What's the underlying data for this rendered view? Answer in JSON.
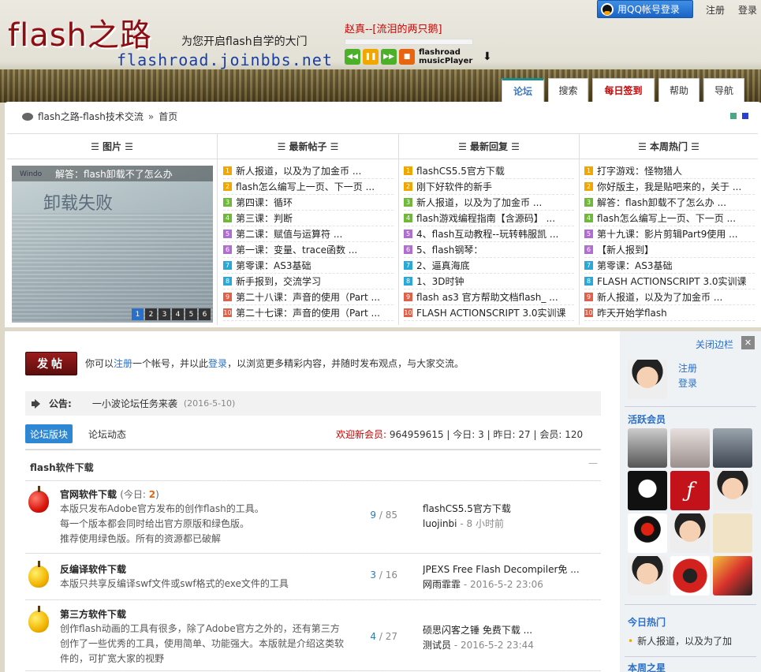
{
  "header": {
    "logo_title": "flash之路",
    "slogan": "为您开启flash自学的大门",
    "url": "flashroad.joinbbs.net",
    "player": {
      "song": "赵真--[流泪的两只鹅]",
      "name_line1": "flashroad",
      "name_line2": "musicPlayer",
      "buttons": [
        "prev-icon",
        "pause-icon",
        "next-icon",
        "stop-icon"
      ]
    },
    "qq_login": "用QQ帐号登录",
    "register": "注册",
    "login": "登录"
  },
  "nav": {
    "tabs": [
      {
        "label": "论坛",
        "state": "active"
      },
      {
        "label": "搜索",
        "state": "normal"
      },
      {
        "label": "每日签到",
        "state": "hot"
      },
      {
        "label": "帮助",
        "state": "normal"
      },
      {
        "label": "导航",
        "state": "normal"
      }
    ]
  },
  "breadcrumb": {
    "site": "flash之路-flash技术交流",
    "sep": "»",
    "current": "首页"
  },
  "columns": {
    "pictures": {
      "title": "☰ 图片 ☰",
      "caption": "解答：flash卸载不了怎么办",
      "big_text": "卸载失败",
      "small_text": "Windo",
      "pages": [
        "1",
        "2",
        "3",
        "4",
        "5",
        "6"
      ],
      "active_page": "1"
    },
    "new_threads": {
      "title": "☰ 最新帖子 ☰",
      "items": [
        "新人报道，以及为了加金币 ...",
        "flash怎么编写上一页、下一页 ...",
        "第四课：循环",
        "第三课：判断",
        "第二课：赋值与运算符 ...",
        "第一课：变量、trace函数 ...",
        "第零课：AS3基础",
        "新手报到，交流学习",
        "第二十八课：声音的使用（Part ...",
        "第二十七课：声音的使用（Part ..."
      ]
    },
    "new_replies": {
      "title": "☰ 最新回复 ☰",
      "items": [
        "flashCS5.5官方下载",
        "刚下好软件的新手",
        "新人报道，以及为了加金币 ...",
        "flash游戏编程指南【含源码】 ...",
        "4、flash互动教程--玩转韩服凯 ...",
        "5、flash钢琴：",
        "2、逼真海底",
        "1、3D时钟",
        "flash as3 官方帮助文档flash_ ...",
        "FLASH ACTIONSCRIPT 3.0实训课"
      ]
    },
    "weekly_hot": {
      "title": "☰ 本周热门 ☰",
      "items": [
        "打字游戏：怪物猎人",
        "你好版主，我是贴吧来的，关于 ...",
        "解答：flash卸载不了怎么办 ...",
        "flash怎么编写上一页、下一页 ...",
        "第十九课：影片剪辑Part9使用 ...",
        "【新人报到】",
        "第零课：AS3基础",
        "FLASH ACTIONSCRIPT 3.0实训课",
        "新人报道，以及为了加金币 ...",
        "昨天开始学flash"
      ]
    },
    "number_labels": [
      "1",
      "2",
      "3",
      "4",
      "5",
      "6",
      "7",
      "8",
      "9",
      "10"
    ],
    "number_colors": [
      "#f2a700",
      "#f2a700",
      "#6fb83a",
      "#6fb83a",
      "#b06fd0",
      "#b06fd0",
      "#2aa8d8",
      "#2aa8d8",
      "#e0604a",
      "#e0604a"
    ]
  },
  "post": {
    "button": "发帖",
    "text_prefix": "你可以",
    "register_link": "注册",
    "text_mid": "一个帐号，并以此",
    "login_link": "登录",
    "text_suffix": "，以浏览更多精彩内容，并随时发布观点，与大家交流。"
  },
  "notice": {
    "label": "公告:",
    "text": "一小波论坛任务来袭",
    "date": "(2016-5-10)"
  },
  "tabs2": {
    "board": "论坛版块",
    "activity": "论坛动态"
  },
  "stats": {
    "welcome_label": "欢迎新会员:",
    "welcome_value": "964959615",
    "today": "今日: 3",
    "yesterday": "昨日: 27",
    "members": "会员: 120",
    "sep": "|"
  },
  "section": {
    "title": "flash软件下载",
    "collapse": "—",
    "forums": [
      {
        "name": "官网软件下载",
        "today_label": "(今日:",
        "today_value": "2",
        "today_close": ")",
        "desc": [
          "本版只发布Adobe官方发布的创作flash的工具。",
          "每一个版本都会同时给出官方原版和绿色版。",
          "推荐使用绿色版。所有的资源都已破解"
        ],
        "threads": "9",
        "posts": "85",
        "last_title": "flashCS5.5官方下载",
        "last_user": "luojinbi",
        "last_time": "8 小时前",
        "icon": "red-apple-icon"
      },
      {
        "name": "反编译软件下载",
        "desc": [
          "本版只共享反编译swf文件或swf格式的exe文件的工具"
        ],
        "threads": "3",
        "posts": "16",
        "last_title": "JPEXS Free Flash Decompiler免 ...",
        "last_user": "网雨霏霏",
        "last_time": "2016-5-2 23:06",
        "icon": "yellow-apple-icon"
      },
      {
        "name": "第三方软件下载",
        "desc": [
          "创作flash动画的工具有很多，除了Adobe官方之外的，还有第三方",
          "创作了一些优秀的工具，使用简单、功能强大。本版就是介绍这类软",
          "件的，可扩宽大家的视野"
        ],
        "threads": "4",
        "posts": "27",
        "last_title": "硕思闪客之锤 免费下载 ...",
        "last_user": "测试员",
        "last_time": "2016-5-2 23:44",
        "icon": "yellow-apple-icon"
      }
    ],
    "count_sep": "/",
    "meta_sep": "-"
  },
  "sidebar": {
    "close": "关闭边栏",
    "close_x": "✕",
    "register": "注册",
    "login": "登录",
    "active_members_title": "活跃会员",
    "today_hot_title": "今日热门",
    "today_hot_item": "新人报道，以及为了加",
    "week_star_title": "本周之星"
  },
  "colors": {
    "accent_blue": "#2a6fc9",
    "hot_red": "#cc0000",
    "post_button": "#8b1a1a"
  }
}
